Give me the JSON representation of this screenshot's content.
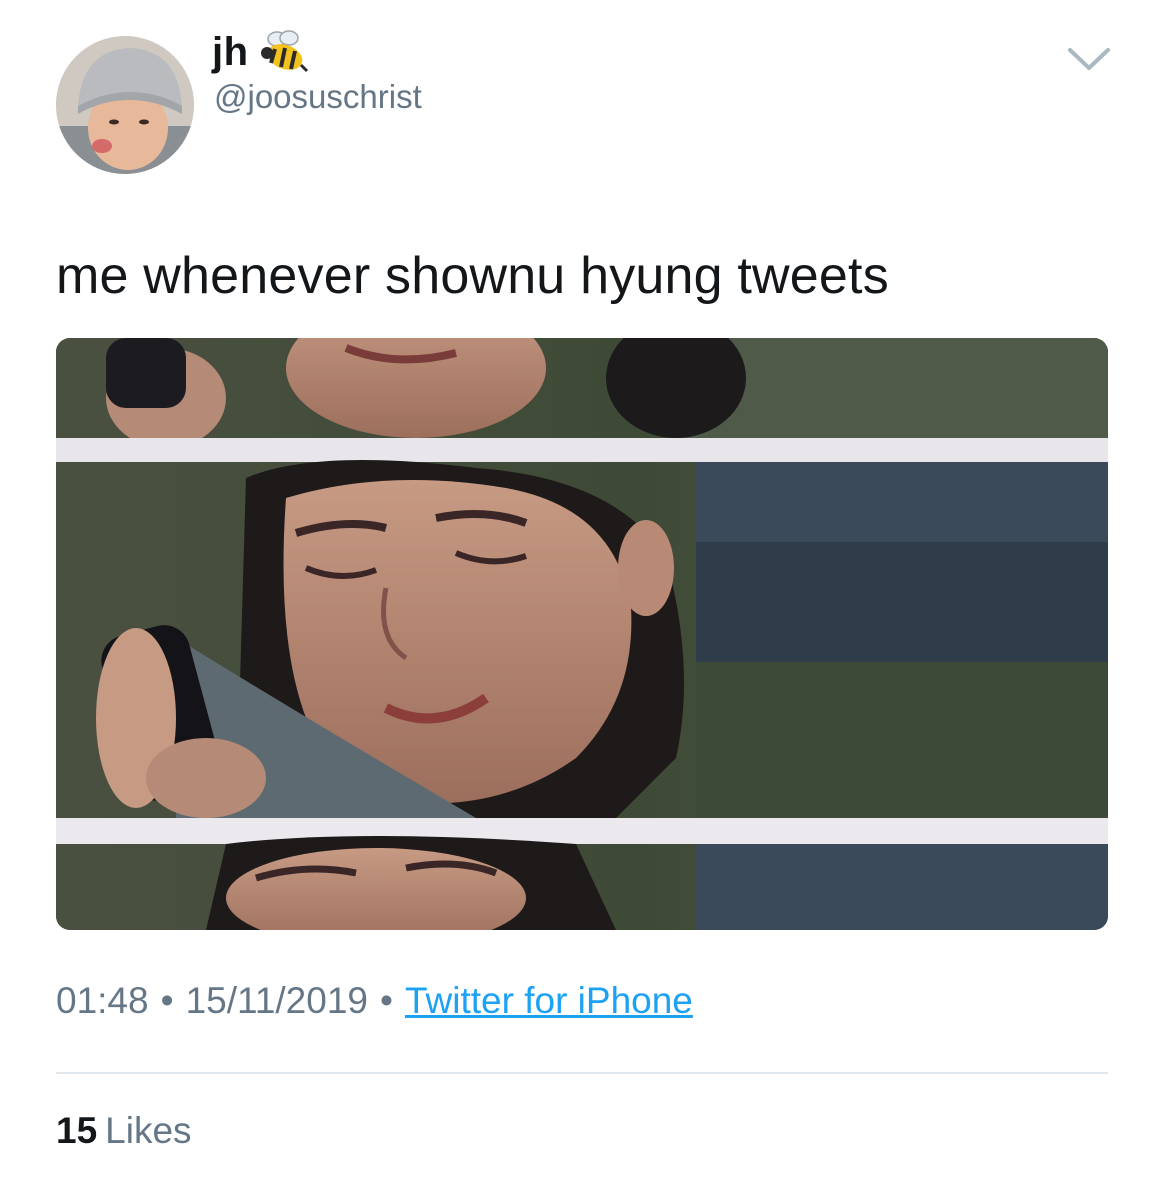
{
  "author": {
    "display_name": "jh",
    "emoji_icon": "bee-icon",
    "handle": "@joosuschrist",
    "avatar_icon": "avatar"
  },
  "header": {
    "menu_icon": "chevron-down-icon"
  },
  "tweet": {
    "text": "me whenever shownu hyung tweets"
  },
  "meta": {
    "time": "01:48",
    "separator": "•",
    "date": "15/11/2019",
    "source": "Twitter for iPhone"
  },
  "stats": {
    "likes_count": "15",
    "likes_label": "Likes"
  },
  "colors": {
    "text_primary": "#14171a",
    "text_secondary": "#657786",
    "link": "#1da1f2",
    "divider": "#e1e8ed"
  }
}
